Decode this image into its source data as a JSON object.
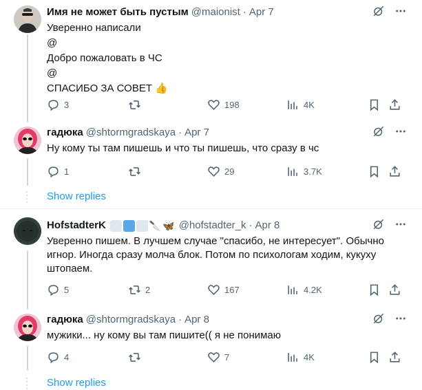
{
  "tweets": [
    {
      "name": "Имя не может быть пустым",
      "handle": "@maionist",
      "sep": "·",
      "date": "Apr 7",
      "lines": [
        "Уверенно написали",
        "@",
        "Добро пожаловать в ЧС",
        "@",
        "СПАСИБО ЗА СОВЕТ 👍"
      ],
      "replies": "3",
      "retweets": "",
      "likes": "198",
      "views": "4K"
    },
    {
      "name": "гадюка",
      "handle": "@shtormgradskaya",
      "sep": "·",
      "date": "Apr 7",
      "lines": [
        "Ну кому ты там пишешь и что ты пишешь, что сразу в чс"
      ],
      "replies": "1",
      "retweets": "",
      "likes": "29",
      "views": "3.7K"
    },
    {
      "name": "HofstadterK",
      "badges": [
        "🔪",
        "🦋"
      ],
      "handle": "@hofstadter_k",
      "sep": "·",
      "date": "Apr 8",
      "lines": [
        "Уверенно пишем. В лучшем случае \"спасибо, не интересует\". Обычно",
        "игнор. Иногда сразу молча блок. Потом по психологам ходим, кукуху",
        "штопаем."
      ],
      "replies": "5",
      "retweets": "2",
      "likes": "167",
      "views": "4.2K"
    },
    {
      "name": "гадюка",
      "handle": "@shtormgradskaya",
      "sep": "·",
      "date": "Apr 8",
      "lines": [
        "мужики... ну кому вы там пишите(( я не понимаю"
      ],
      "replies": "4",
      "retweets": "",
      "likes": "7",
      "views": "4K"
    }
  ],
  "show_replies_label": "Show replies",
  "colors": {
    "text": "#0f1419",
    "muted": "#536471",
    "link": "#1d9bf0",
    "line": "#cfd9de"
  }
}
